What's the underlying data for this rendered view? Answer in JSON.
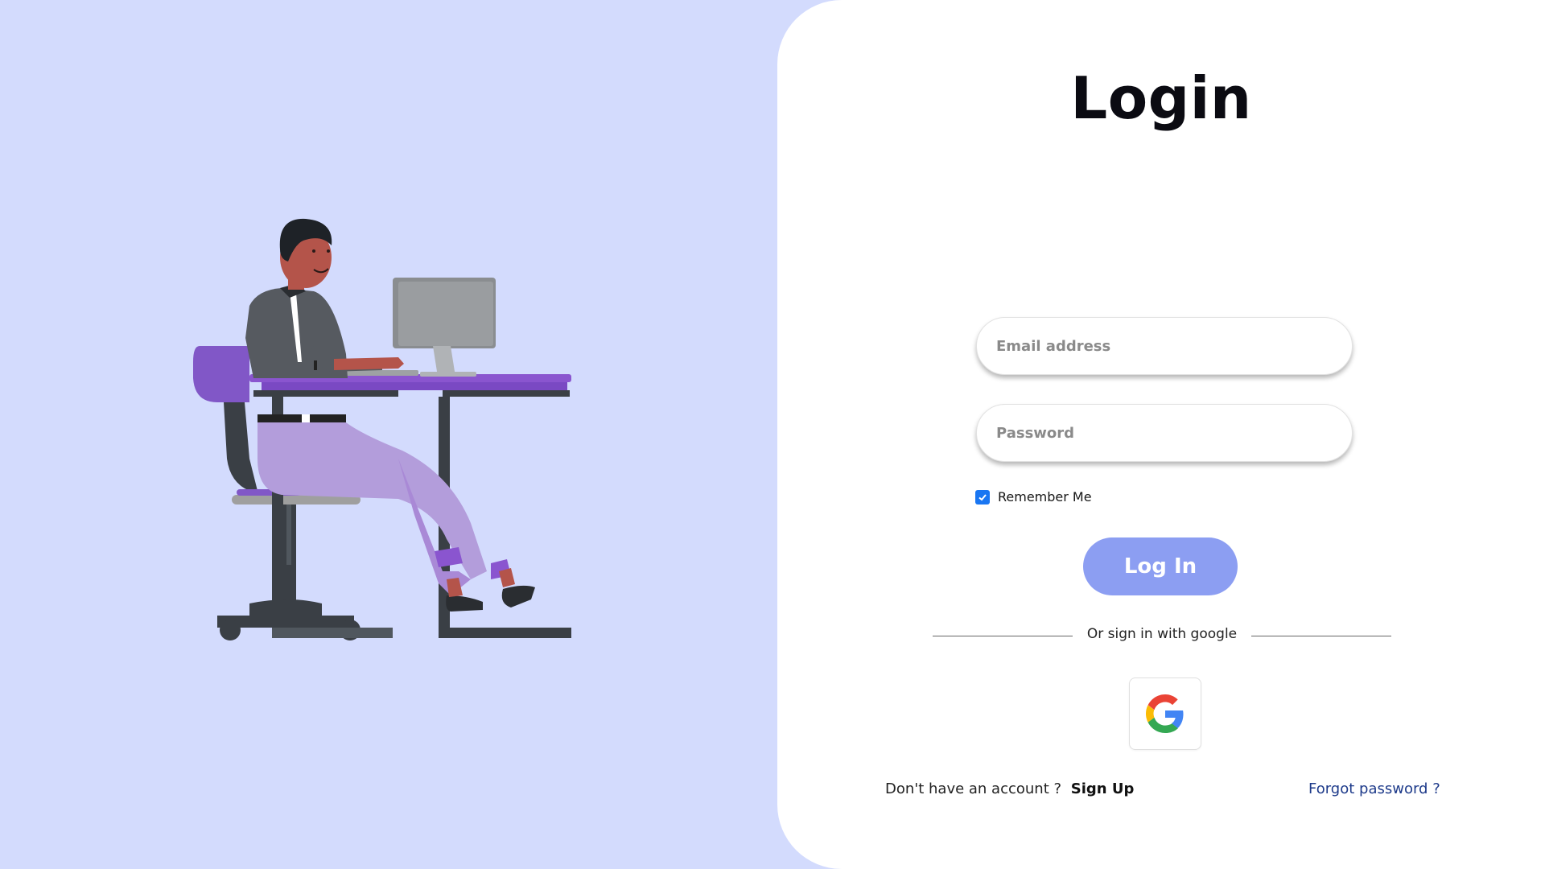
{
  "login": {
    "title": "Login",
    "email_placeholder": "Email address",
    "password_placeholder": "Password",
    "remember_label": "Remember Me",
    "remember_checked": true,
    "login_button": "Log In",
    "divider_text": "Or sign in with google",
    "no_account_text": "Don't have an account ?",
    "signup_link": "Sign Up",
    "forgot_link": "Forgot password ?",
    "google_icon": "google-g-icon"
  },
  "colors": {
    "background": "#d3dbfd",
    "primary_button": "#8c9ef2",
    "checkbox": "#1976f2",
    "forgot_link": "#1d3a8a",
    "chair_accent": "#8157c7",
    "desk_accent": "#8a55cf",
    "pants": "#b39ddb"
  }
}
